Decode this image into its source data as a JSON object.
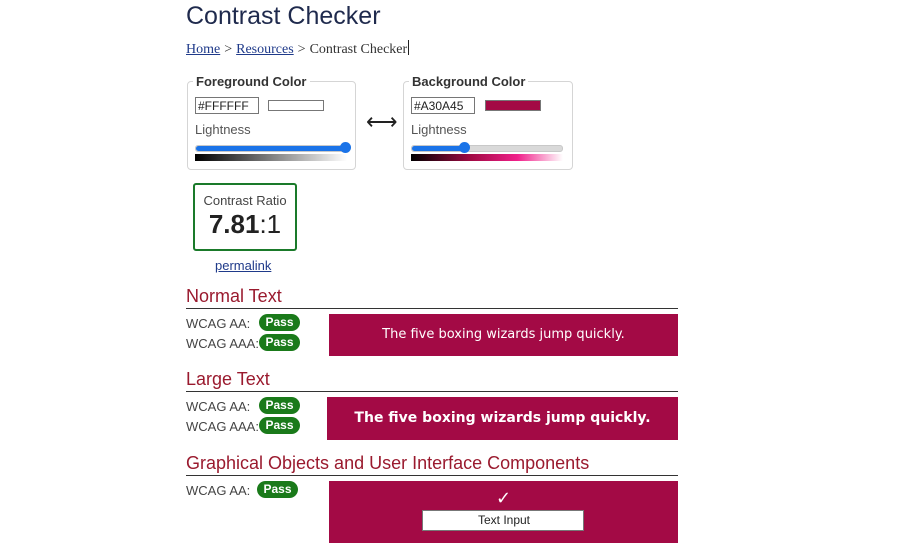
{
  "page": {
    "title": "Contrast Checker"
  },
  "breadcrumb": {
    "home": "Home",
    "resources": "Resources",
    "current": "Contrast Checker",
    "separator": ">"
  },
  "foreground": {
    "legend": "Foreground Color",
    "hex_value": "#FFFFFF",
    "color": "#FFFFFF",
    "lightness_label": "Lightness",
    "lightness_percent": 100
  },
  "background": {
    "legend": "Background Color",
    "hex_value": "#A30A45",
    "color": "#A30A45",
    "lightness_label": "Lightness",
    "lightness_percent": 35
  },
  "swap": {
    "icon": "left-right-arrow-icon",
    "glyph": "⟷"
  },
  "ratio": {
    "label": "Contrast Ratio",
    "value": "7.81",
    "suffix": ":1",
    "border_color": "#1A7A2A"
  },
  "permalink": "permalink",
  "sections": {
    "normal": {
      "heading": "Normal Text",
      "aa_label": "WCAG AA:",
      "aa_result": "Pass",
      "aaa_label": "WCAG AAA:",
      "aaa_result": "Pass",
      "sample": "The five boxing wizards jump quickly."
    },
    "large": {
      "heading": "Large Text",
      "aa_label": "WCAG AA:",
      "aa_result": "Pass",
      "aaa_label": "WCAG AAA:",
      "aaa_result": "Pass",
      "sample": "The five boxing wizards jump quickly."
    },
    "graphical": {
      "heading": "Graphical Objects and User Interface Components",
      "aa_label": "WCAG AA:",
      "aa_result": "Pass",
      "check_icon": "checkmark-icon",
      "check_glyph": "✓",
      "input_text": "Text Input"
    }
  },
  "colors": {
    "pass": "#1A7A1A",
    "heading": "#9A1A2E",
    "link": "#1F3A8A"
  }
}
